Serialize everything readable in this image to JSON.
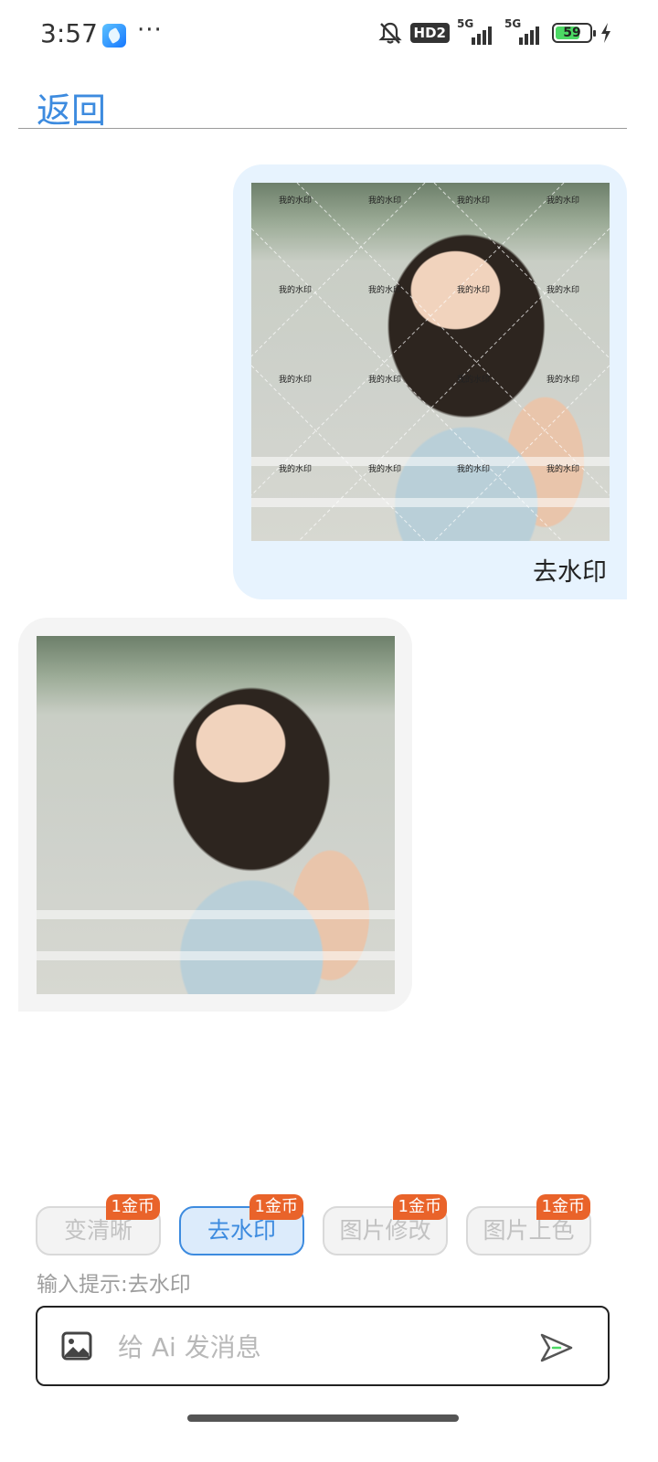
{
  "status_bar": {
    "time": "3:57",
    "more": "···",
    "hd_badge": "HD2",
    "sim1": "5G",
    "sim2": "5G",
    "battery": "59"
  },
  "header": {
    "back_label": "返回"
  },
  "messages": {
    "user": {
      "text": "去水印",
      "watermark_text": "我的水印"
    },
    "ai": {}
  },
  "chips": [
    {
      "label": "变清晰",
      "cost": "1金币",
      "state": "disabled"
    },
    {
      "label": "去水印",
      "cost": "1金币",
      "state": "active"
    },
    {
      "label": "图片修改",
      "cost": "1金币",
      "state": "disabled"
    },
    {
      "label": "图片上色",
      "cost": "1金币",
      "state": "disabled"
    }
  ],
  "hint": {
    "label": "输入提示:",
    "value": "去水印"
  },
  "input": {
    "placeholder": "给 Ai 发消息",
    "value": ""
  },
  "colors": {
    "accent": "#3d8bdf",
    "coin_badge": "#e9632a",
    "user_bubble": "#e7f3fe",
    "ai_bubble": "#f4f4f4"
  },
  "icons": [
    "notification-off-icon",
    "signal-icon",
    "battery-icon",
    "charging-icon",
    "image-icon",
    "send-icon"
  ]
}
